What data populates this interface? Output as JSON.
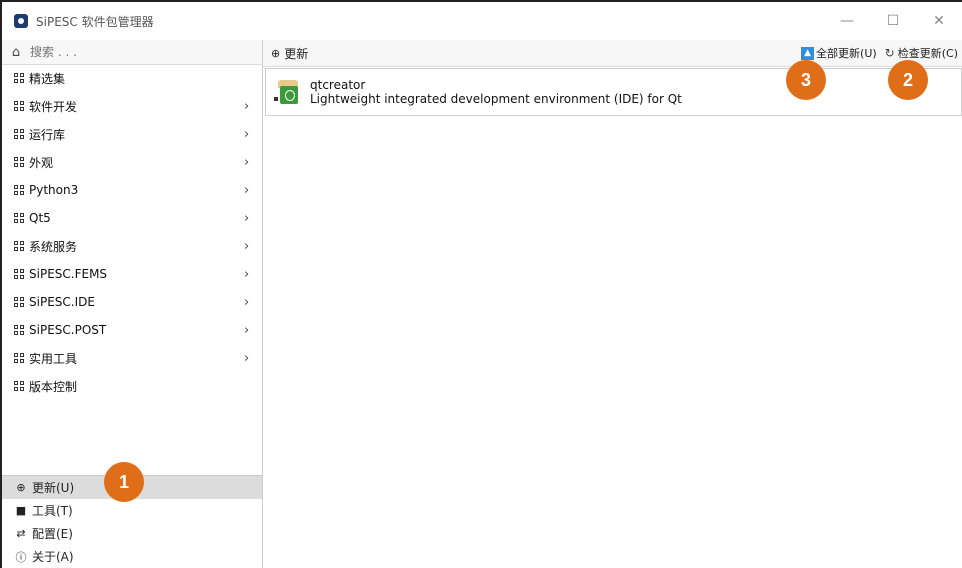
{
  "window": {
    "title": "SiPESC 软件包管理器",
    "controls": [
      "—",
      "☐",
      "✕"
    ]
  },
  "search": {
    "placeholder": "搜索 . . ."
  },
  "categories": [
    {
      "label": "精选集",
      "has_children": false
    },
    {
      "label": "软件开发",
      "has_children": true
    },
    {
      "label": "运行库",
      "has_children": true
    },
    {
      "label": "外观",
      "has_children": true
    },
    {
      "label": "Python3",
      "has_children": true
    },
    {
      "label": "Qt5",
      "has_children": true
    },
    {
      "label": "系统服务",
      "has_children": true
    },
    {
      "label": "SiPESC.FEMS",
      "has_children": true
    },
    {
      "label": "SiPESC.IDE",
      "has_children": true
    },
    {
      "label": "SiPESC.POST",
      "has_children": true
    },
    {
      "label": "实用工具",
      "has_children": true
    },
    {
      "label": "版本控制",
      "has_children": false
    }
  ],
  "chevron": "›",
  "bottom_nav": [
    {
      "label": "更新(U)",
      "icon": "⊕",
      "active": true
    },
    {
      "label": "工具(T)",
      "icon": "■",
      "active": false
    },
    {
      "label": "配置(E)",
      "icon": "⇄",
      "active": false
    },
    {
      "label": "关于(A)",
      "icon": "ⓘ",
      "active": false
    }
  ],
  "toolbar": {
    "title": "更新",
    "title_icon": "⊕",
    "update_all_label": "全部更新(U)",
    "check_updates_label": "检查更新(C)",
    "up_icon": "▲",
    "refresh_icon": "↻"
  },
  "packages": [
    {
      "name": "qtcreator",
      "description": "Lightweight integrated development environment (IDE) for Qt"
    }
  ],
  "markers": [
    "1",
    "2",
    "3"
  ],
  "colors": {
    "marker": "#e06e19",
    "accent": "#2f8ee0",
    "active_nav": "#dcdcdc"
  }
}
